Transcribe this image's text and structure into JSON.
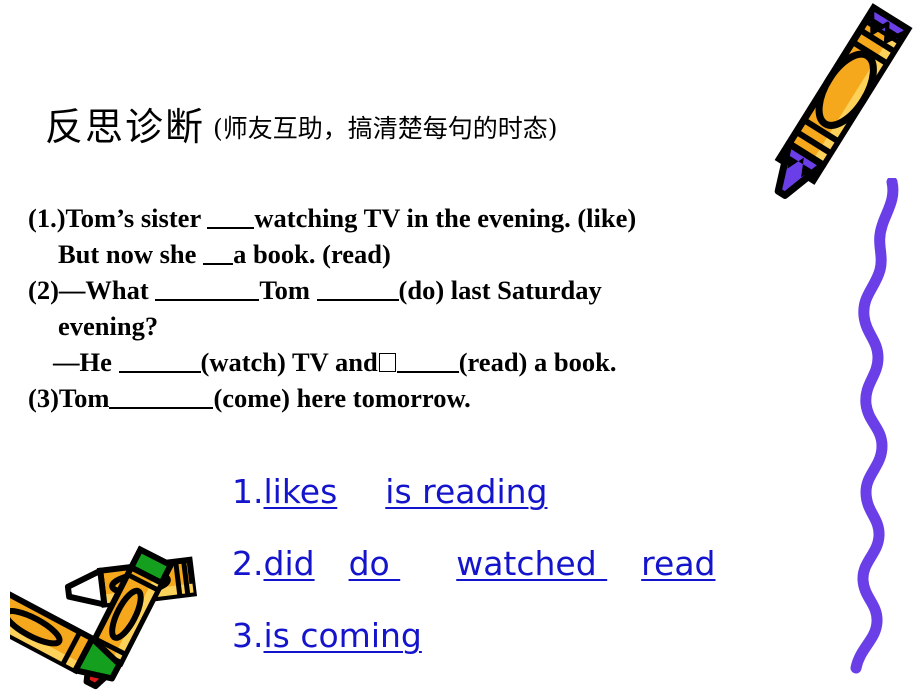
{
  "slide": {
    "title": {
      "main": "反思诊断",
      "sub": "(师友互助，搞清楚每句的时态)"
    },
    "questions": [
      {
        "id": "q1a",
        "pre": "(1.)Tom’s sister ",
        "blank": "b-s",
        "post": "watching TV in the evening. (like)",
        "indent": 0
      },
      {
        "id": "q1b",
        "pre": "But now she ",
        "blank": "b-xs",
        "post": "a book. (read)",
        "indent": 1
      },
      {
        "id": "q2a",
        "pre": "(2)—What ",
        "blank": "b-xl",
        "post": "Tom ",
        "blank2": "b-l",
        "post2": "(do) last Saturday",
        "indent": 0
      },
      {
        "id": "q2b",
        "pre": "evening?",
        "indent": 1
      },
      {
        "id": "q2c",
        "pre": "—He ",
        "blank": "b-l",
        "post": "(watch) TV and",
        "tofu": true,
        "blank2": "b-m",
        "post2": "(read) a book.",
        "indent": 2
      },
      {
        "id": "q3",
        "pre": "(3)Tom",
        "blank": "b-xl",
        "post": "(come) here  tomorrow.",
        "indent": 0
      }
    ],
    "answers": [
      {
        "num": "1.",
        "words": [
          "likes",
          "is reading"
        ]
      },
      {
        "num": "2.",
        "words": [
          "did",
          "do  ",
          "watched ",
          "read"
        ]
      },
      {
        "num": "3.",
        "words": [
          "is coming"
        ]
      }
    ],
    "colors": {
      "answer_blue": "#1414CC",
      "crayon_yellow": "#F5A81C",
      "crayon_yellow_light": "#FDD25B",
      "crayon_purple": "#6B3FE8",
      "crayon_green": "#14A01E",
      "crayon_red": "#E01B1B",
      "outline_black": "#000000",
      "background": "#FFFFFF"
    },
    "art": {
      "crayon_top_right": "purple-crayon-icon",
      "squiggle": "purple-squiggle-line-icon",
      "crayons_bottom_left": "crossed-crayons-icon"
    }
  }
}
